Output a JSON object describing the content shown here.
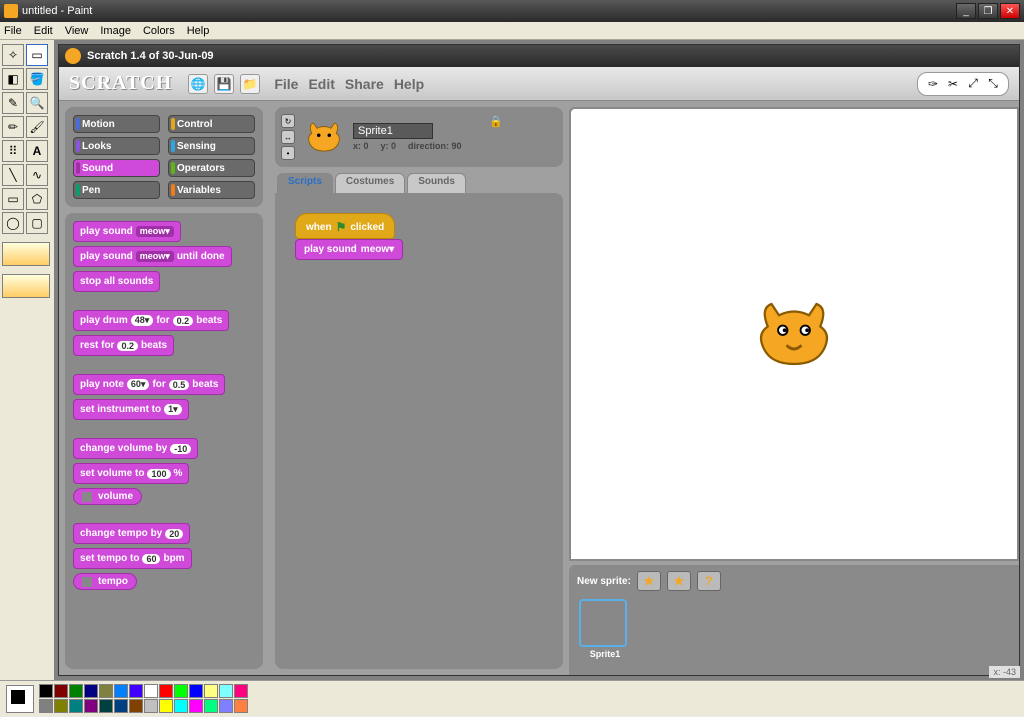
{
  "paint": {
    "title": "untitled - Paint",
    "menus": [
      "File",
      "Edit",
      "View",
      "Image",
      "Colors",
      "Help"
    ]
  },
  "scratch": {
    "title": "Scratch 1.4 of 30-Jun-09",
    "logo": "SCRATCH",
    "menus": [
      "File",
      "Edit",
      "Share",
      "Help"
    ],
    "categories": {
      "motion": "Motion",
      "control": "Control",
      "looks": "Looks",
      "sensing": "Sensing",
      "sound": "Sound",
      "operators": "Operators",
      "pen": "Pen",
      "variables": "Variables"
    },
    "sound_blocks": {
      "b1": "play sound",
      "b1s": "meow▾",
      "b2": "play sound",
      "b2s": "meow▾",
      "b2t": "until done",
      "b3": "stop all sounds",
      "b4a": "play drum",
      "b4s1": "48▾",
      "b4b": "for",
      "b4s2": "0.2",
      "b4c": "beats",
      "b5a": "rest for",
      "b5s": "0.2",
      "b5b": "beats",
      "b6a": "play note",
      "b6s1": "60▾",
      "b6b": "for",
      "b6s2": "0.5",
      "b6c": "beats",
      "b7a": "set instrument to",
      "b7s": "1▾",
      "b8a": "change volume by",
      "b8s": "-10",
      "b9a": "set volume to",
      "b9s": "100",
      "b9b": "%",
      "b10": "volume",
      "b11a": "change tempo by",
      "b11s": "20",
      "b12a": "set tempo to",
      "b12s": "60",
      "b12b": "bpm",
      "b13": "tempo"
    },
    "sprite": {
      "name": "Sprite1",
      "x": "x: 0",
      "y": "y: 0",
      "dir": "direction: 90"
    },
    "tabs": {
      "scripts": "Scripts",
      "costumes": "Costumes",
      "sounds": "Sounds"
    },
    "script": {
      "hat_a": "when",
      "hat_b": "clicked",
      "s1": "play sound",
      "s1s": "meow▾"
    },
    "stage_coord": "x: -43",
    "new_sprite": "New sprite:",
    "sprite_list": {
      "item1": "Sprite1"
    }
  },
  "palette_colors": [
    "#000",
    "#808080",
    "#800000",
    "#808000",
    "#008000",
    "#008080",
    "#000080",
    "#800080",
    "#808040",
    "#004040",
    "#0080ff",
    "#004080",
    "#4000ff",
    "#804000",
    "#fff",
    "#c0c0c0",
    "#ff0000",
    "#ffff00",
    "#00ff00",
    "#00ffff",
    "#0000ff",
    "#ff00ff",
    "#ffff80",
    "#00ff80",
    "#80ffff",
    "#8080ff",
    "#ff0080",
    "#ff8040"
  ]
}
